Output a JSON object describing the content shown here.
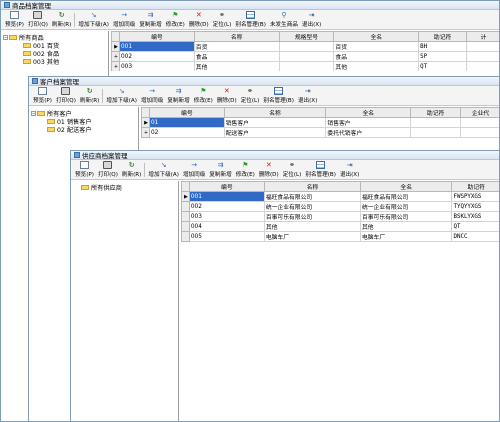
{
  "toolbar_common": {
    "preview": "预览(P)",
    "print": "打印(Q)",
    "refresh": "刷新(R)",
    "add_lower": "增加下级(A)",
    "add_same": "增加同级",
    "copy_add": "复制新增",
    "modify": "修改(E)",
    "delete": "删除(D)",
    "locate": "定位(L)",
    "alias": "别名管理(B)",
    "exit": "退出(X)"
  },
  "win_goods": {
    "title": "商品档案管理",
    "extra_button": "未发生商品",
    "tree": {
      "root": "所有商品",
      "items": [
        "001 百货",
        "002 食品",
        "003 其他"
      ]
    },
    "columns": [
      "编号",
      "名称",
      "规格型号",
      "全名",
      "助记符",
      "计"
    ],
    "rows": [
      [
        "001",
        "百货",
        "",
        "百货",
        "BH"
      ],
      [
        "002",
        "食品",
        "",
        "食品",
        "SP"
      ],
      [
        "003",
        "其他",
        "",
        "其他",
        "QT"
      ]
    ]
  },
  "win_customer": {
    "title": "客户档案管理",
    "tree": {
      "root": "所有客户",
      "items": [
        "01 销售客户",
        "02 配送客户"
      ]
    },
    "columns": [
      "编号",
      "名称",
      "全名",
      "助记符",
      "企业代"
    ],
    "rows": [
      [
        "01",
        "销售客户",
        "销售客户",
        ""
      ],
      [
        "02",
        "配送客户",
        "委托代销客户",
        ""
      ]
    ]
  },
  "win_supplier": {
    "title": "供应商档案管理",
    "tree": {
      "root": "所有供应商"
    },
    "columns": [
      "编号",
      "名称",
      "全名",
      "助记符"
    ],
    "rows": [
      [
        "001",
        "福旺食品有限公司",
        "福旺食品有限公司",
        "FWSPYXGS"
      ],
      [
        "002",
        "统一企业有限公司",
        "统一企业有限公司",
        "TYQYYXGS"
      ],
      [
        "003",
        "百事可乐有限公司",
        "百事可乐有限公司",
        "BSKLYXGS"
      ],
      [
        "004",
        "其他",
        "其他",
        "QT"
      ],
      [
        "005",
        "电脑车厂",
        "电脑车厂",
        "DNCC"
      ]
    ]
  },
  "icons": {
    "preview": "document-icon",
    "print": "printer-icon",
    "refresh": "refresh-icon",
    "add_lower": "add-lower-icon",
    "add_same": "add-same-icon",
    "copy_add": "copy-add-icon",
    "modify": "edit-flag-icon",
    "delete": "delete-x-icon",
    "locate": "binoculars-icon",
    "alias": "grid-icon",
    "extra": "search-icon",
    "exit": "exit-door-icon"
  },
  "colors": {
    "selection": "#3169c6",
    "folder": "#f7d76a",
    "header": "#ececec"
  }
}
